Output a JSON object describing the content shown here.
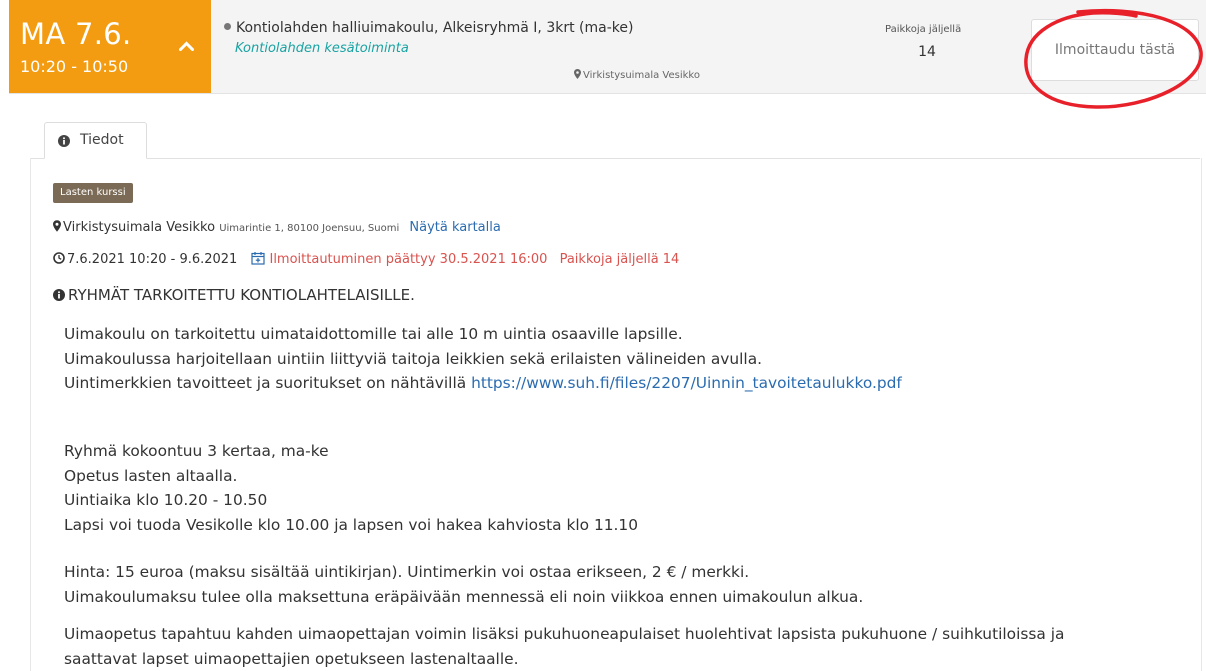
{
  "header": {
    "day": "MA 7.6.",
    "time_range": "10:20 - 10:50",
    "course_title": "Kontiolahden halliuimakoulu, Alkeisryhmä I, 3krt (ma-ke)",
    "organizer": "Kontiolahden kesätoiminta",
    "location": "Virkistysuimala Vesikko",
    "spots_label": "Paikkoja jäljellä",
    "spots_count": "14",
    "enroll_label": "Ilmoittaudu tästä",
    "highlight_color": "#e8202a",
    "accent_color": "#f39c12"
  },
  "tabs": [
    {
      "label": "Tiedot",
      "icon": "info-circle-icon"
    }
  ],
  "details": {
    "badge": "Lasten kurssi",
    "venue": "Virkistysuimala Vesikko",
    "address": "Uimarintie 1, 80100 Joensuu, Suomi",
    "map_link": "Näytä kartalla",
    "dates": "7.6.2021 10:20 - 9.6.2021",
    "registration_ended": "Ilmoittautuminen päättyy 30.5.2021 16:00",
    "spots_left": "Paikkoja jäljellä 14",
    "notice": "RYHMÄT TARKOITETTU KONTIOLAHTELAISILLE."
  },
  "description": {
    "line1": "Uimakoulu on tarkoitettu uimataidottomille tai alle 10 m uintia osaaville lapsille.",
    "line2": "Uimakoulussa harjoitellaan uintiin liittyviä taitoja leikkien sekä erilaisten välineiden avulla.",
    "line3": "Uintimerkkien tavoitteet ja suoritukset on nähtävillä",
    "link": "https://www.suh.fi/files/2207/Uinnin_tavoitetaulukko.pdf",
    "line4": "Ryhmä kokoontuu 3 kertaa, ma-ke",
    "line5": "Opetus lasten altaalla.",
    "line6": "Uintiaika klo 10.20 - 10.50",
    "line7": "Lapsi voi tuoda Vesikolle klo 10.00 ja lapsen voi hakea kahviosta klo 11.10",
    "line8": "Hinta: 15 euroa (maksu sisältää uintikirjan). Uintimerkin voi ostaa erikseen, 2 € / merkki.",
    "line9": "Uimakoulumaksu tulee olla maksettuna eräpäivään mennessä eli noin viikkoa ennen uimakoulun alkua.",
    "line10": "Uimaopetus tapahtuu kahden uimaopettajan voimin lisäksi pukuhuoneapulaiset huolehtivat lapsista pukuhuone / suihkutiloissa ja",
    "line11": "saattavat lapset uimaopettajien opetukseen lastenaltaalle."
  }
}
